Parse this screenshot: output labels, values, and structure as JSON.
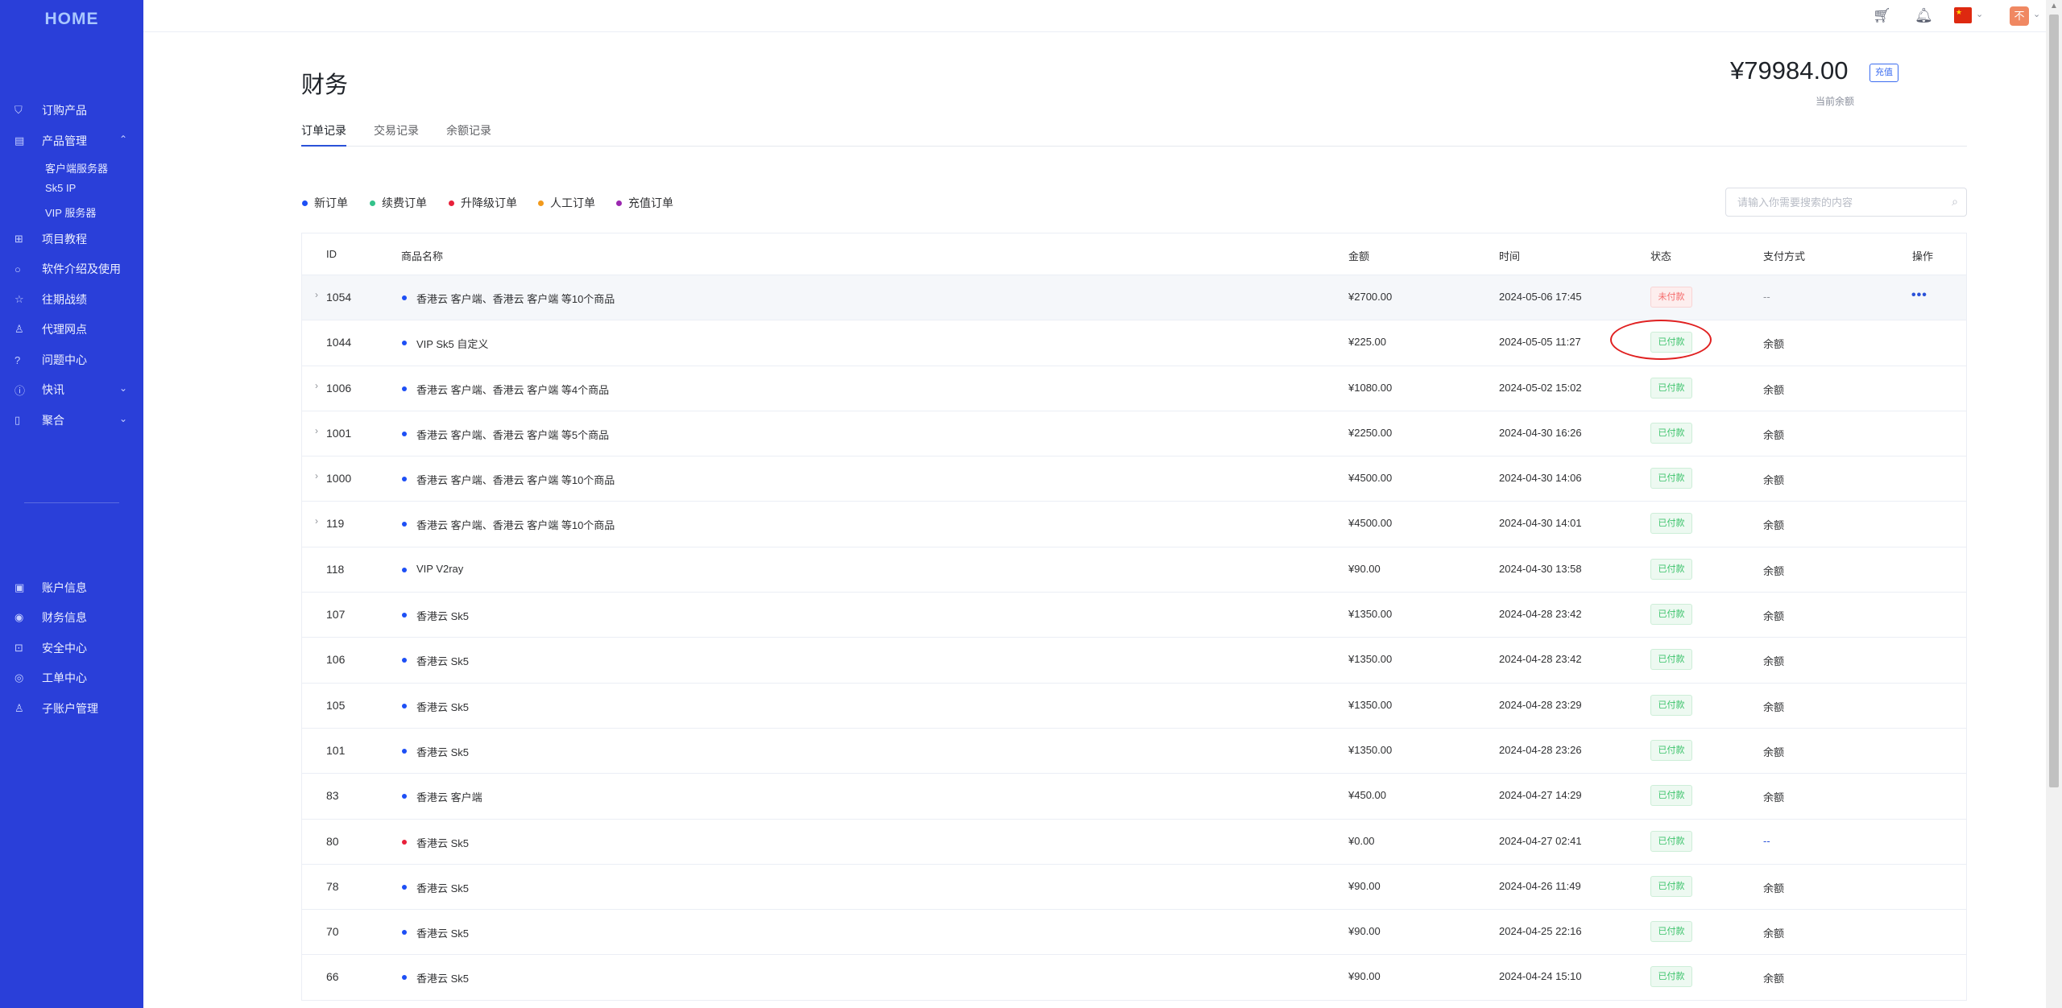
{
  "sidebar": {
    "logo": "HOME",
    "items": [
      {
        "label": "订购产品",
        "icon": "cart-icon"
      },
      {
        "label": "产品管理",
        "icon": "server-icon"
      },
      {
        "label": "项目教程",
        "icon": "grid-icon"
      },
      {
        "label": "软件介绍及使用",
        "icon": "circle-icon"
      },
      {
        "label": "往期战绩",
        "icon": "star-icon"
      },
      {
        "label": "代理网点",
        "icon": "user-group-icon"
      },
      {
        "label": "问题中心",
        "icon": "question-icon"
      },
      {
        "label": "快讯",
        "icon": "info-icon"
      },
      {
        "label": "聚合",
        "icon": "bookmark-icon"
      }
    ],
    "sub_items": [
      "客户端服务器",
      "Sk5 IP",
      "VIP 服务器"
    ],
    "bottom_items": [
      {
        "label": "账户信息",
        "icon": "id-card-icon"
      },
      {
        "label": "财务信息",
        "icon": "finance-icon"
      },
      {
        "label": "安全中心",
        "icon": "lock-icon"
      },
      {
        "label": "工单中心",
        "icon": "ticket-icon"
      },
      {
        "label": "子账户管理",
        "icon": "sub-account-icon"
      }
    ]
  },
  "header": {
    "avatar_text": "不"
  },
  "page": {
    "title": "财务",
    "balance": "¥79984.00",
    "recharge_label": "充值",
    "balance_label": "当前余额",
    "tabs": [
      "订单记录",
      "交易记录",
      "余额记录"
    ]
  },
  "legend": [
    {
      "label": "新订单",
      "color": "#1d4ff5"
    },
    {
      "label": "续费订单",
      "color": "#33c28a"
    },
    {
      "label": "升降级订单",
      "color": "#e8203a"
    },
    {
      "label": "人工订单",
      "color": "#f29a1c"
    },
    {
      "label": "充值订单",
      "color": "#9b27b0"
    }
  ],
  "search": {
    "placeholder": "请输入你需要搜索的内容"
  },
  "table": {
    "headers": [
      "ID",
      "商品名称",
      "金额",
      "时间",
      "状态",
      "支付方式",
      "操作"
    ],
    "rows": [
      {
        "id": "1054",
        "expand": true,
        "dot": "#1d4ff5",
        "name": "香港云 客户端、香港云 客户端 等10个商品",
        "amount": "¥2700.00",
        "time": "2024-05-06 17:45",
        "status": "未付款",
        "paid": false,
        "pay": "--",
        "ops": "•••"
      },
      {
        "id": "1044",
        "expand": false,
        "dot": "#1d4ff5",
        "name": "VIP Sk5 自定义",
        "amount": "¥225.00",
        "time": "2024-05-05 11:27",
        "status": "已付款",
        "paid": true,
        "pay": "余额"
      },
      {
        "id": "1006",
        "expand": true,
        "dot": "#1d4ff5",
        "name": "香港云 客户端、香港云 客户端 等4个商品",
        "amount": "¥1080.00",
        "time": "2024-05-02 15:02",
        "status": "已付款",
        "paid": true,
        "pay": "余额"
      },
      {
        "id": "1001",
        "expand": true,
        "dot": "#1d4ff5",
        "name": "香港云 客户端、香港云 客户端 等5个商品",
        "amount": "¥2250.00",
        "time": "2024-04-30 16:26",
        "status": "已付款",
        "paid": true,
        "pay": "余额"
      },
      {
        "id": "1000",
        "expand": true,
        "dot": "#1d4ff5",
        "name": "香港云 客户端、香港云 客户端 等10个商品",
        "amount": "¥4500.00",
        "time": "2024-04-30 14:06",
        "status": "已付款",
        "paid": true,
        "pay": "余额"
      },
      {
        "id": "119",
        "expand": true,
        "dot": "#1d4ff5",
        "name": "香港云 客户端、香港云 客户端 等10个商品",
        "amount": "¥4500.00",
        "time": "2024-04-30 14:01",
        "status": "已付款",
        "paid": true,
        "pay": "余额"
      },
      {
        "id": "118",
        "expand": false,
        "dot": "#1d4ff5",
        "name": "VIP V2ray",
        "amount": "¥90.00",
        "time": "2024-04-30 13:58",
        "status": "已付款",
        "paid": true,
        "pay": "余额"
      },
      {
        "id": "107",
        "expand": false,
        "dot": "#1d4ff5",
        "name": "香港云 Sk5",
        "amount": "¥1350.00",
        "time": "2024-04-28 23:42",
        "status": "已付款",
        "paid": true,
        "pay": "余额"
      },
      {
        "id": "106",
        "expand": false,
        "dot": "#1d4ff5",
        "name": "香港云 Sk5",
        "amount": "¥1350.00",
        "time": "2024-04-28 23:42",
        "status": "已付款",
        "paid": true,
        "pay": "余额"
      },
      {
        "id": "105",
        "expand": false,
        "dot": "#1d4ff5",
        "name": "香港云 Sk5",
        "amount": "¥1350.00",
        "time": "2024-04-28 23:29",
        "status": "已付款",
        "paid": true,
        "pay": "余额"
      },
      {
        "id": "101",
        "expand": false,
        "dot": "#1d4ff5",
        "name": "香港云 Sk5",
        "amount": "¥1350.00",
        "time": "2024-04-28 23:26",
        "status": "已付款",
        "paid": true,
        "pay": "余额"
      },
      {
        "id": "83",
        "expand": false,
        "dot": "#1d4ff5",
        "name": "香港云 客户端",
        "amount": "¥450.00",
        "time": "2024-04-27 14:29",
        "status": "已付款",
        "paid": true,
        "pay": "余额"
      },
      {
        "id": "80",
        "expand": false,
        "dot": "#e8203a",
        "name": "香港云 Sk5",
        "amount": "¥0.00",
        "time": "2024-04-27 02:41",
        "status": "已付款",
        "paid": true,
        "pay": "--",
        "pay_link": true
      },
      {
        "id": "78",
        "expand": false,
        "dot": "#1d4ff5",
        "name": "香港云 Sk5",
        "amount": "¥90.00",
        "time": "2024-04-26 11:49",
        "status": "已付款",
        "paid": true,
        "pay": "余额"
      },
      {
        "id": "70",
        "expand": false,
        "dot": "#1d4ff5",
        "name": "香港云 Sk5",
        "amount": "¥90.00",
        "time": "2024-04-25 22:16",
        "status": "已付款",
        "paid": true,
        "pay": "余额"
      },
      {
        "id": "66",
        "expand": false,
        "dot": "#1d4ff5",
        "name": "香港云 Sk5",
        "amount": "¥90.00",
        "time": "2024-04-24 15:10",
        "status": "已付款",
        "paid": true,
        "pay": "余额"
      }
    ]
  },
  "colors": {
    "sidebar_bg": "#2a3fd9",
    "accent": "#2a52d8",
    "paid_text": "#3ec46d",
    "unpaid_text": "#f56c6c",
    "annotation": "#e02020"
  }
}
